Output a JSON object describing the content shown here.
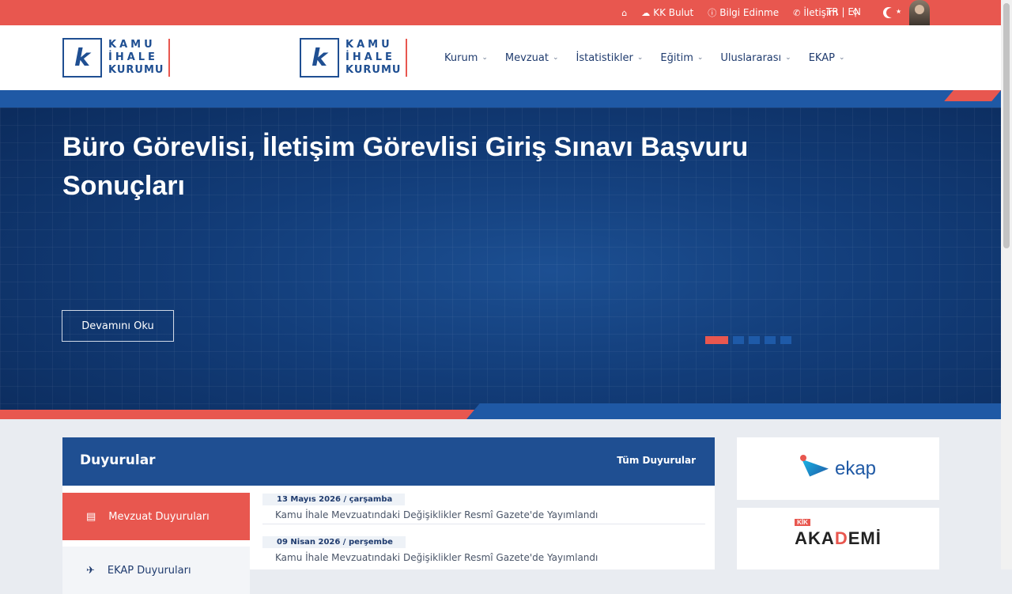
{
  "topbar": {
    "links": [
      {
        "icon": "home-icon",
        "glyph": "⌂",
        "label": ""
      },
      {
        "icon": "cloud-icon",
        "glyph": "☁",
        "label": "KK Bulut"
      },
      {
        "icon": "info-icon",
        "glyph": "ⓘ",
        "label": "Bilgi Edinme"
      },
      {
        "icon": "phone-icon",
        "glyph": "✆",
        "label": "İletişim"
      },
      {
        "icon": "search-icon",
        "glyph": "⚲",
        "label": ""
      }
    ],
    "lang": "TR | EN"
  },
  "logo": {
    "letter": "k",
    "line1": "KAMU",
    "line2": "İHALE",
    "line3": "KURUMU"
  },
  "nav": [
    {
      "label": "Kurum"
    },
    {
      "label": "Mevzuat"
    },
    {
      "label": "İstatistikler"
    },
    {
      "label": "Eğitim"
    },
    {
      "label": "Uluslararası"
    },
    {
      "label": "EKAP"
    }
  ],
  "hero": {
    "title": "Büro Görevlisi, İletişim Görevlisi Giriş Sınavı Başvuru Sonuçları",
    "button": "Devamını Oku",
    "slides": 5,
    "active_slide": 1
  },
  "announcements": {
    "title": "Duyurular",
    "all_link": "Tüm Duyurular",
    "categories": [
      {
        "label": "Mevzuat Duyuruları",
        "icon": "document-icon"
      },
      {
        "label": "EKAP Duyuruları",
        "icon": "plane-icon"
      }
    ],
    "items": [
      {
        "date": "13 Mayıs 2026 / çarşamba",
        "title": "Kamu İhale Mevzuatındaki Değişiklikler Resmî Gazete'de Yayımlandı"
      },
      {
        "date": "09 Nisan 2026 / perşembe",
        "title": "Kamu İhale Mevzuatındaki Değişiklikler Resmî Gazete'de Yayımlandı"
      }
    ]
  },
  "tiles": [
    {
      "name": "ekap",
      "label": "ekap"
    },
    {
      "name": "akademi",
      "tag": "KİK",
      "label_a": "AKA",
      "label_b": "D",
      "label_c": "EMİ"
    }
  ],
  "colors": {
    "red": "#e8574f",
    "navy": "#1f4f92",
    "blue": "#1f59a5"
  }
}
